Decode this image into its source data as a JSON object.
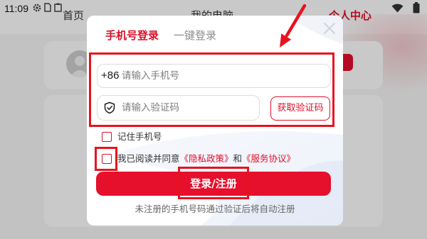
{
  "status_bar": {
    "time": "11:09",
    "left_icons": [
      "settings-icon",
      "sim-card-icon",
      "clipboard-icon"
    ],
    "right_icons": [
      "wifi-icon",
      "battery-icon"
    ]
  },
  "background_tabs": [
    {
      "label": "首页",
      "active": false
    },
    {
      "label": "我的电脑",
      "active": false
    },
    {
      "label": "个人中心",
      "active": true
    }
  ],
  "login_modal": {
    "tabs": [
      {
        "label": "手机号登录",
        "active": true
      },
      {
        "label": "一键登录",
        "active": false
      }
    ],
    "close_icon": "close-icon",
    "phone_field": {
      "country_code": "+86",
      "placeholder": "请输入手机号",
      "value": ""
    },
    "code_field": {
      "icon": "shield-check-icon",
      "placeholder": "请输入验证码",
      "value": ""
    },
    "get_code_label": "获取验证码",
    "remember_phone": {
      "label": "记住手机号",
      "checked": false
    },
    "agreement": {
      "checked": false,
      "prefix": "我已阅读并同意",
      "privacy_link": "《隐私政策》",
      "conjunction": "和",
      "service_link": "《服务协议》"
    },
    "submit_label": "登录/注册",
    "footer_note": "未注册的手机号码通过验证后将自动注册"
  },
  "colors": {
    "accent": "#e60f2c",
    "annotation": "#e8121e",
    "placeholder": "#7d7d7d",
    "tab_inactive": "#8c8c8c"
  }
}
